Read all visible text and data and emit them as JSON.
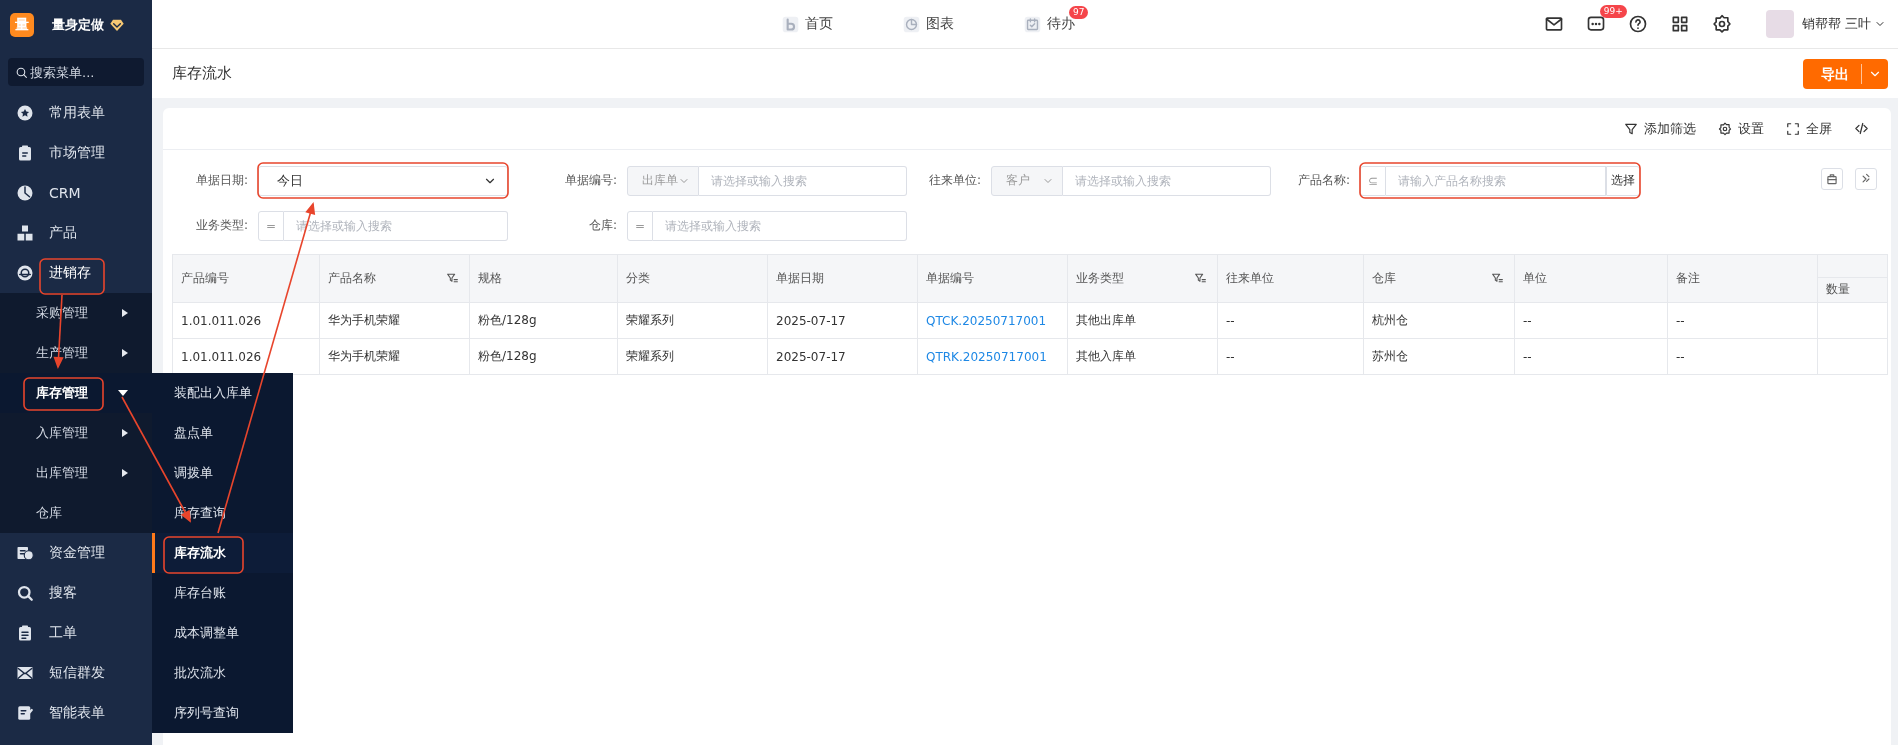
{
  "app": {
    "logo": "量",
    "name": "量身定做"
  },
  "sidebar": {
    "search_placeholder": "搜索菜单...",
    "items": [
      {
        "label": "常用表单"
      },
      {
        "label": "市场管理"
      },
      {
        "label": "CRM"
      },
      {
        "label": "产品"
      },
      {
        "label": "进销存",
        "expanded": true,
        "children": [
          {
            "label": "采购管理",
            "kind": "submenu",
            "expanded": false
          },
          {
            "label": "生产管理",
            "kind": "submenu",
            "expanded": false
          },
          {
            "label": "库存管理",
            "kind": "submenu",
            "expanded": true,
            "children": [
              {
                "label": "装配出入库单",
                "selected": false
              },
              {
                "label": "盘点单",
                "selected": false
              },
              {
                "label": "调拨单",
                "selected": false
              },
              {
                "label": "库存查询",
                "selected": false
              },
              {
                "label": "库存流水",
                "selected": true
              },
              {
                "label": "库存台账",
                "selected": false
              },
              {
                "label": "成本调整单",
                "selected": false
              },
              {
                "label": "批次流水",
                "selected": false
              },
              {
                "label": "序列号查询",
                "selected": false
              }
            ]
          },
          {
            "label": "入库管理",
            "kind": "submenu",
            "expanded": false
          },
          {
            "label": "出库管理",
            "kind": "submenu",
            "expanded": false
          },
          {
            "label": "仓库",
            "kind": "link"
          }
        ]
      },
      {
        "label": "资金管理"
      },
      {
        "label": "搜客"
      },
      {
        "label": "工单"
      },
      {
        "label": "短信群发"
      },
      {
        "label": "智能表单"
      }
    ]
  },
  "top_nav": [
    {
      "label": "首页"
    },
    {
      "label": "图表"
    },
    {
      "label": "待办",
      "badge": "97"
    }
  ],
  "top_right": {
    "message_badge": "99+",
    "user": "销帮帮 三叶"
  },
  "page": {
    "title": "库存流水",
    "export_button": "导出"
  },
  "toolbar": [
    {
      "label": "添加筛选"
    },
    {
      "label": "设置"
    },
    {
      "label": "全屏"
    }
  ],
  "filters": [
    {
      "label": "单据日期:",
      "kind": "select",
      "value": "今日"
    },
    {
      "label": "单据编号:",
      "kind": "prefixed",
      "prefix": "出库单",
      "placeholder": "请选择或输入搜索"
    },
    {
      "label": "往来单位:",
      "kind": "prefixed",
      "prefix": "客户",
      "placeholder": "请选择或输入搜索"
    },
    {
      "label": "产品名称:",
      "kind": "operator",
      "operator": "⊆",
      "placeholder": "请输入产品名称搜索",
      "action": "选择"
    },
    {
      "label": "业务类型:",
      "kind": "operator",
      "operator": "=",
      "placeholder": "请选择或输入搜索"
    },
    {
      "label": "仓库:",
      "kind": "operator",
      "operator": "=",
      "placeholder": "请选择或输入搜索"
    }
  ],
  "table": {
    "columns": [
      {
        "label": "产品编号",
        "kind": "text",
        "filterable": false
      },
      {
        "label": "产品名称",
        "kind": "text",
        "filterable": true
      },
      {
        "label": "规格",
        "kind": "text",
        "filterable": false
      },
      {
        "label": "分类",
        "kind": "text",
        "filterable": false
      },
      {
        "label": "单据日期",
        "kind": "text",
        "filterable": false
      },
      {
        "label": "单据编号",
        "kind": "link",
        "filterable": false
      },
      {
        "label": "业务类型",
        "kind": "text",
        "filterable": true
      },
      {
        "label": "往来单位",
        "kind": "text",
        "filterable": false
      },
      {
        "label": "仓库",
        "kind": "text",
        "filterable": true
      },
      {
        "label": "单位",
        "kind": "text",
        "filterable": false
      },
      {
        "label": "备注",
        "kind": "text",
        "filterable": false
      },
      {
        "label": "数量",
        "kind": "subheader",
        "filterable": false
      }
    ],
    "rows": [
      [
        "1.01.011.026",
        "华为手机荣耀",
        "粉色/128g",
        "荣耀系列",
        "2025-07-17",
        "QTCK.20250717001",
        "其他出库单",
        "--",
        "杭州仓",
        "--",
        "--"
      ],
      [
        "1.01.011.026",
        "华为手机荣耀",
        "粉色/128g",
        "荣耀系列",
        "2025-07-17",
        "QTRK.20250717001",
        "其他入库单",
        "--",
        "苏州仓",
        "--",
        "--"
      ]
    ]
  }
}
